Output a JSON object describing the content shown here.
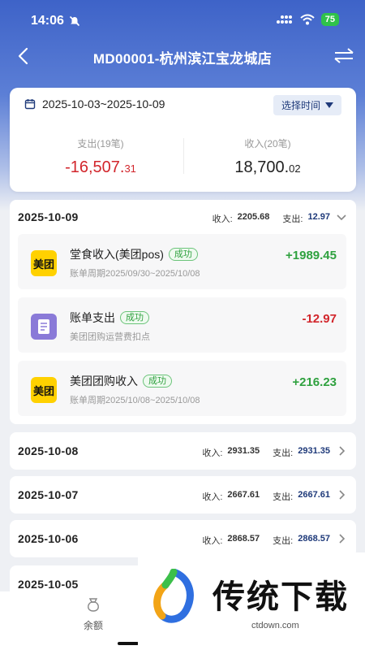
{
  "status": {
    "time": "14:06",
    "battery": "75"
  },
  "nav": {
    "title": "MD00001-杭州滨江宝龙城店"
  },
  "summary": {
    "date_range": "2025-10-03~2025-10-09",
    "select_time_label": "选择时间",
    "expense_label": "支出(19笔)",
    "expense_int": "-16,507.",
    "expense_dec": "31",
    "income_label": "收入(20笔)",
    "income_int": "18,700.",
    "income_dec": "02"
  },
  "days": [
    {
      "date": "2025-10-09",
      "income_label": "收入:",
      "income": "2205.68",
      "expense_label": "支出:",
      "expense": "12.97",
      "expanded": true,
      "transactions": [
        {
          "icon": "meituan-logo-icon",
          "icon_text": "美团",
          "name": "堂食收入(美团pos)",
          "badge": "成功",
          "sub": "账单周期2025/09/30~2025/10/08",
          "amount": "+1989.45",
          "type": "pos"
        },
        {
          "icon": "bill-icon",
          "icon_text": "",
          "name": "账单支出",
          "badge": "成功",
          "sub": "美团团购运营费扣点",
          "amount": "-12.97",
          "type": "neg"
        },
        {
          "icon": "meituan-logo-icon",
          "icon_text": "美团",
          "name": "美团团购收入",
          "badge": "成功",
          "sub": "账单周期2025/10/08~2025/10/08",
          "amount": "+216.23",
          "type": "pos"
        }
      ]
    },
    {
      "date": "2025-10-08",
      "income_label": "收入:",
      "income": "2931.35",
      "expense_label": "支出:",
      "expense": "2931.35"
    },
    {
      "date": "2025-10-07",
      "income_label": "收入:",
      "income": "2667.61",
      "expense_label": "支出:",
      "expense": "2667.61"
    },
    {
      "date": "2025-10-06",
      "income_label": "收入:",
      "income": "2868.57",
      "expense_label": "支出:",
      "expense": "2868.57"
    },
    {
      "date": "2025-10-05"
    }
  ],
  "tabbar": {
    "balance_label": "余额"
  },
  "ad": {
    "text": "传统下载",
    "domain": "ctdown.com"
  },
  "colors": {
    "header_blue": "#3e63c8",
    "income_green": "#2fa13f",
    "expense_red": "#d2262c",
    "expense_blue": "#1f3a7a",
    "meituan_yellow": "#ffd100"
  }
}
